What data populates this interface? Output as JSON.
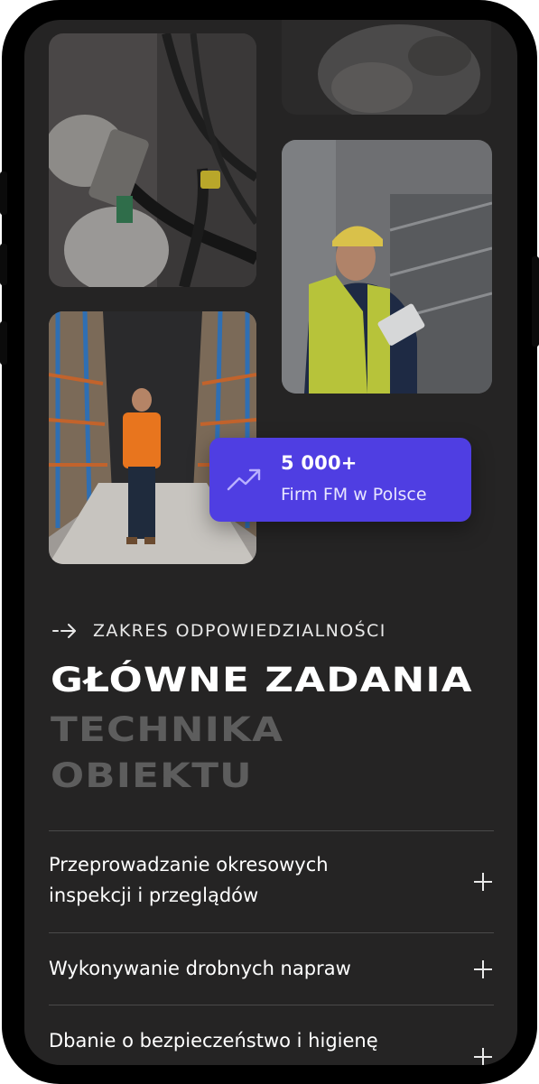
{
  "stat": {
    "value": "5 000+",
    "label": "Firm FM w Polsce",
    "icon": "trending-up-icon"
  },
  "section": {
    "eyebrow": "ZAKRES ODPOWIEDZIALNOŚCI",
    "heading_main": "GŁÓWNE ZADANIA",
    "heading_sub1": "TECHNIKA",
    "heading_sub2": "OBIEKTU"
  },
  "accordion": {
    "items": [
      {
        "title_line1": "Przeprowadzanie okresowych",
        "title_line2": "inspekcji i przeglądów"
      },
      {
        "title_line1": "Wykonywanie drobnych napraw"
      },
      {
        "title_line1": "Dbanie o bezpieczeństwo i higienę"
      }
    ]
  },
  "colors": {
    "accent": "#4f3ee2",
    "background": "#252424",
    "heading": "#ffffff",
    "heading_muted": "#5d5d5d"
  }
}
